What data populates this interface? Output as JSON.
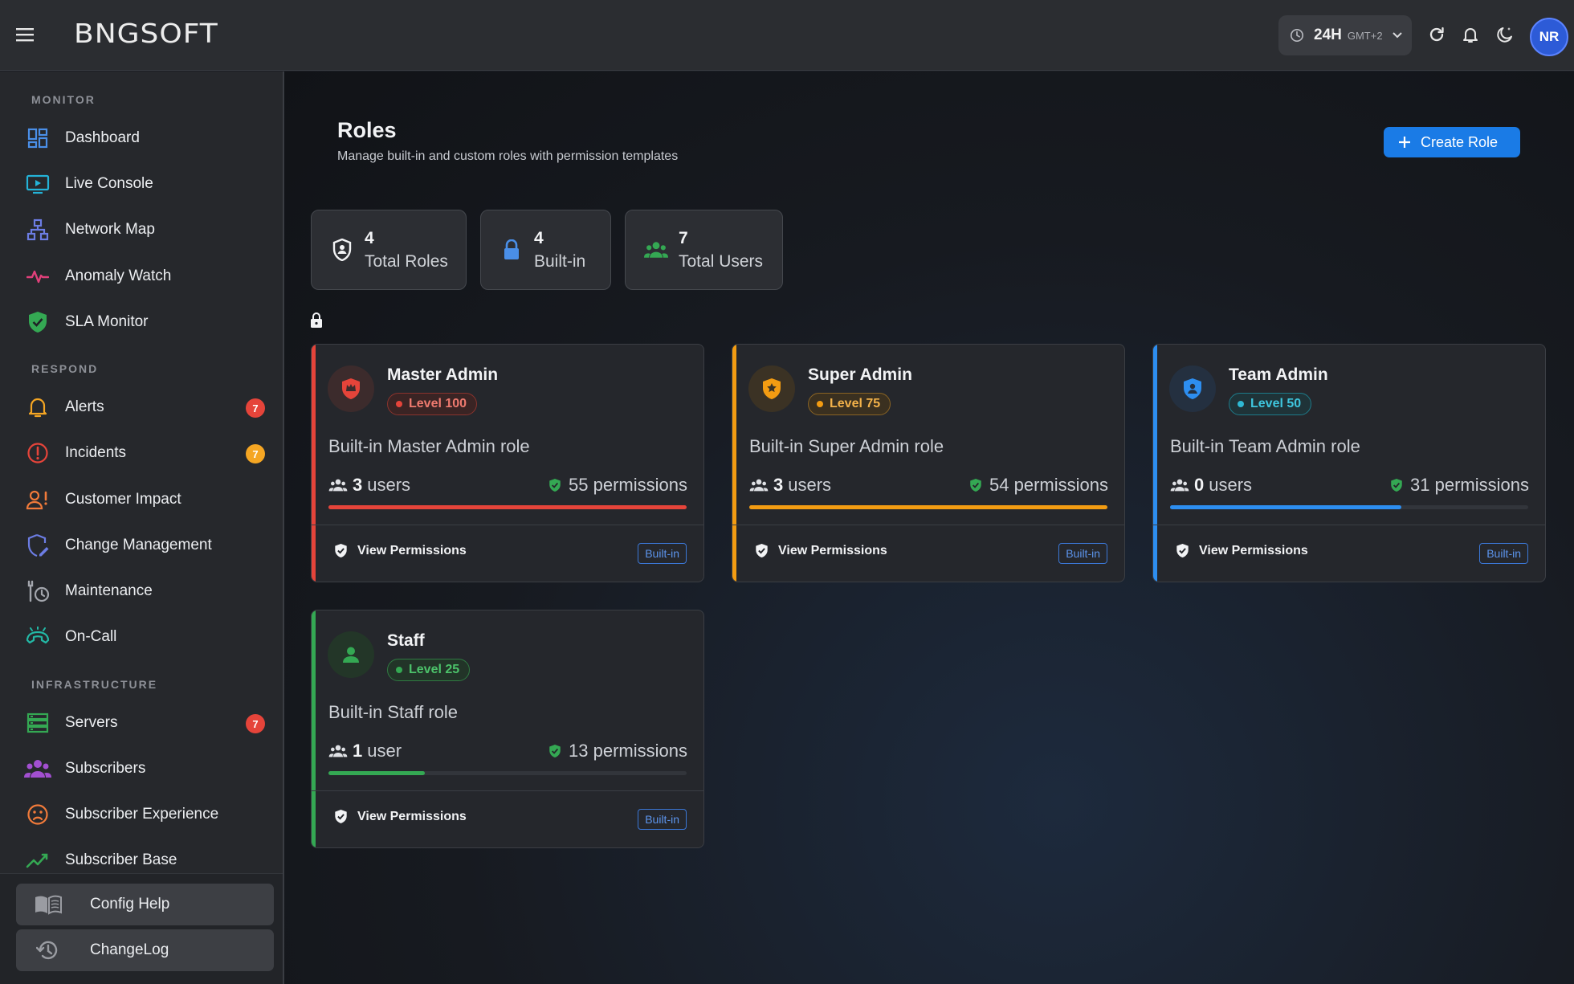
{
  "app": {
    "logo": "BNGSOFT"
  },
  "topbar": {
    "time_mode": "24H",
    "timezone": "GMT+2",
    "avatar_initials": "NR"
  },
  "sidebar": {
    "sections": [
      {
        "label": "MONITOR"
      },
      {
        "label": "RESPOND"
      },
      {
        "label": "INFRASTRUCTURE"
      }
    ],
    "items": [
      {
        "label": "Dashboard",
        "icon": "dashboard-icon"
      },
      {
        "label": "Live Console",
        "icon": "live-console-icon"
      },
      {
        "label": "Network Map",
        "icon": "network-map-icon"
      },
      {
        "label": "Anomaly Watch",
        "icon": "pulse-icon"
      },
      {
        "label": "SLA Monitor",
        "icon": "shield-check-icon"
      },
      {
        "label": "Alerts",
        "icon": "bell-icon",
        "badge": "7"
      },
      {
        "label": "Incidents",
        "icon": "alert-circle-icon",
        "badge": "7"
      },
      {
        "label": "Customer Impact",
        "icon": "person-alert-icon"
      },
      {
        "label": "Change Management",
        "icon": "shield-edit-icon"
      },
      {
        "label": "Maintenance",
        "icon": "wrench-clock-icon"
      },
      {
        "label": "On-Call",
        "icon": "phone-icon"
      },
      {
        "label": "Servers",
        "icon": "server-icon",
        "badge": "7"
      },
      {
        "label": "Subscribers",
        "icon": "group-icon"
      },
      {
        "label": "Subscriber Experience",
        "icon": "sad-face-icon"
      },
      {
        "label": "Subscriber Base",
        "icon": "trend-up-icon"
      }
    ],
    "bottom": [
      {
        "label": "Config Help",
        "icon": "book-icon"
      },
      {
        "label": "ChangeLog",
        "icon": "history-icon"
      }
    ]
  },
  "main": {
    "title": "Roles",
    "subtitle": "Manage built-in and custom roles with permission templates",
    "create_label": "Create Role",
    "stats": [
      {
        "value": "4",
        "label": "Total Roles"
      },
      {
        "value": "4",
        "label": "Built-in"
      },
      {
        "value": "7",
        "label": "Total Users"
      }
    ],
    "roles": [
      {
        "name": "Master Admin",
        "level": "Level 100",
        "description": "Built-in Master Admin role",
        "users_count": "3",
        "users_word": "users",
        "permissions": "55 permissions",
        "permission_fill": 1.0,
        "view_label": "View Permissions",
        "tag": "Built-in",
        "color": "#e5443a"
      },
      {
        "name": "Super Admin",
        "level": "Level 75",
        "description": "Built-in Super Admin role",
        "users_count": "3",
        "users_word": "users",
        "permissions": "54 permissions",
        "permission_fill": 1.0,
        "view_label": "View Permissions",
        "tag": "Built-in",
        "color": "#f39c12"
      },
      {
        "name": "Team Admin",
        "level": "Level 50",
        "description": "Built-in Team Admin role",
        "users_count": "0",
        "users_word": "users",
        "permissions": "31 permissions",
        "permission_fill": 0.646,
        "view_label": "View Permissions",
        "tag": "Built-in",
        "color": "#2d8ef0"
      },
      {
        "name": "Staff",
        "level": "Level 25",
        "description": "Built-in Staff role",
        "users_count": "1",
        "users_word": "user",
        "permissions": "13 permissions",
        "permission_fill": 0.27,
        "view_label": "View Permissions",
        "tag": "Built-in",
        "color": "#34a853"
      }
    ]
  }
}
